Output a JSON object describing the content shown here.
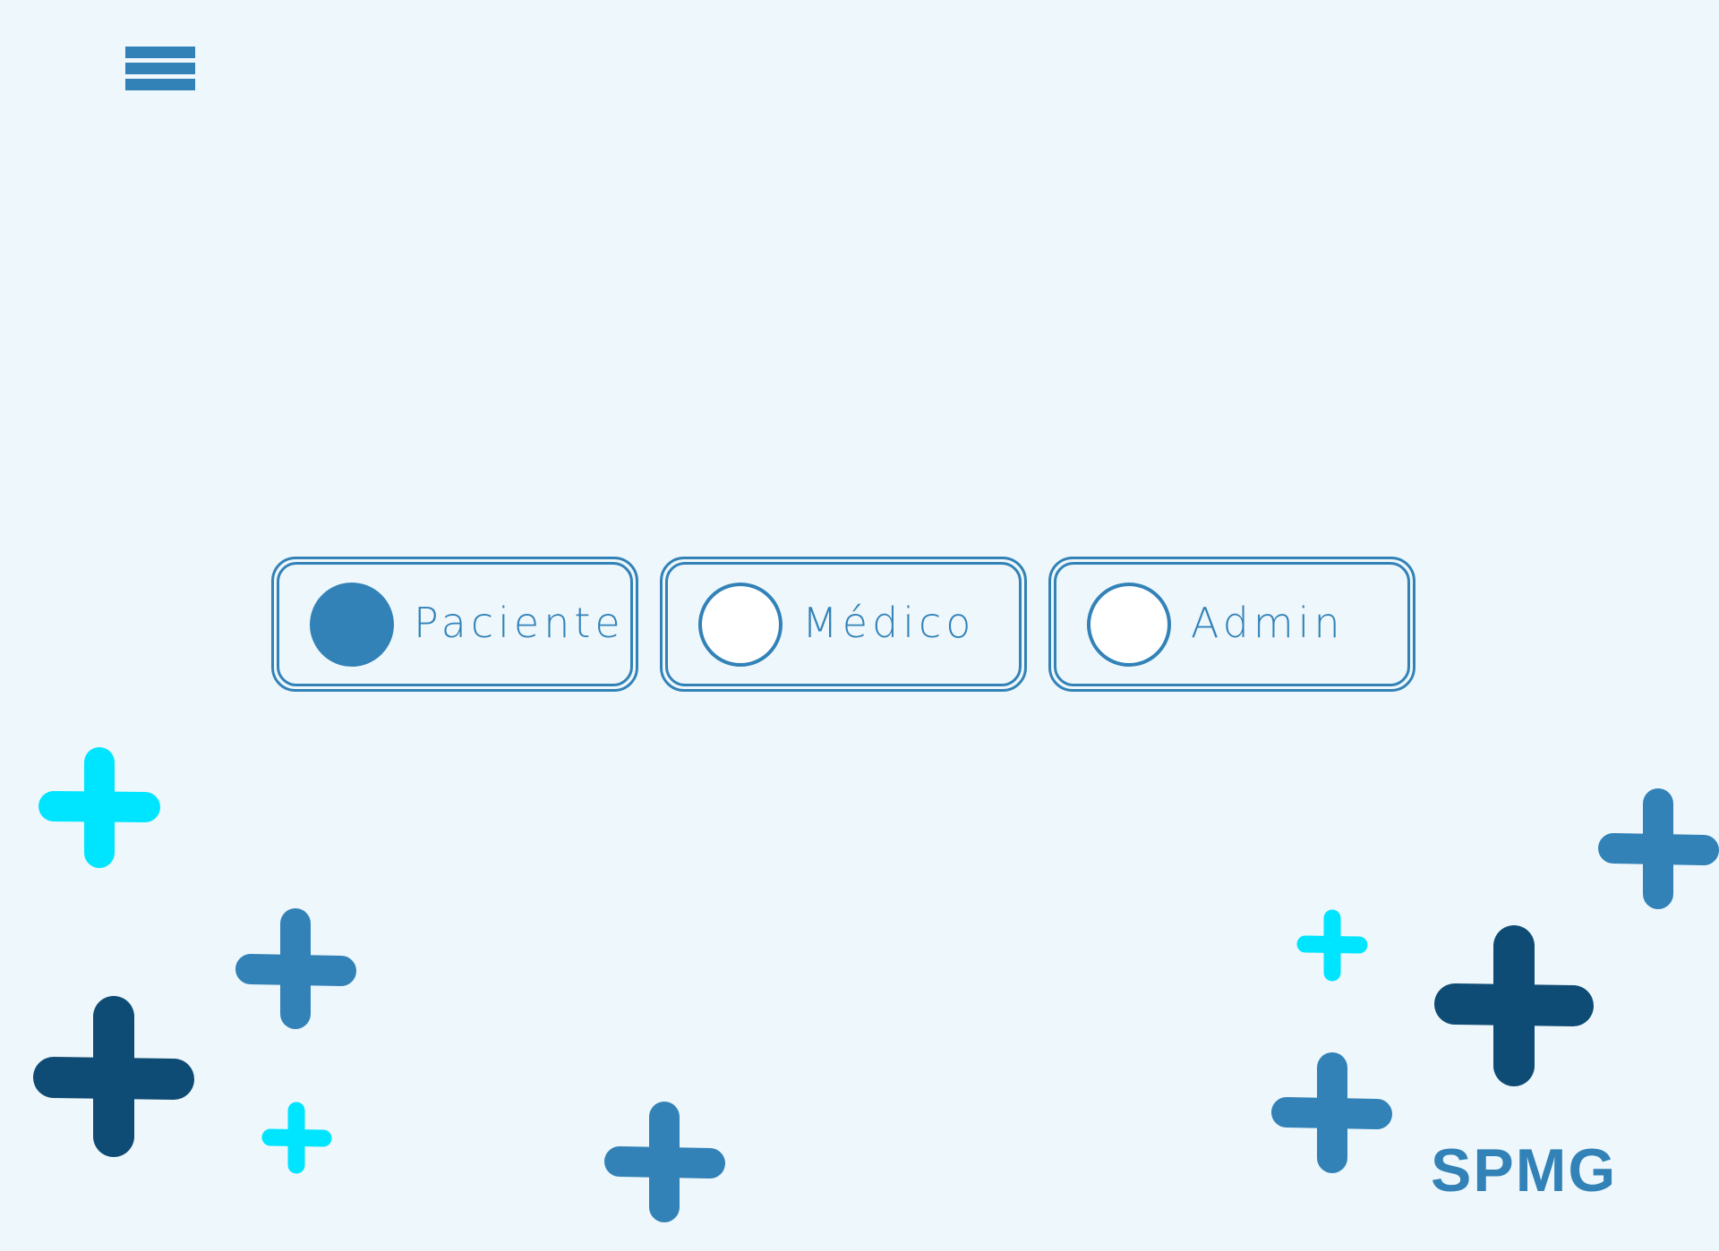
{
  "app": {
    "brand": "SPMG"
  },
  "header": {
    "menu_icon": "hamburger-menu-icon"
  },
  "role_selector": {
    "options": [
      {
        "label": "Paciente",
        "selected": true
      },
      {
        "label": "Médico",
        "selected": false
      },
      {
        "label": "Admin",
        "selected": false
      }
    ]
  },
  "colors": {
    "background": "#eef7fb",
    "primary": "#3282b8",
    "dark": "#0f4c75",
    "accent": "#00e5ff"
  },
  "decorations": {
    "icon": "plus-icon"
  }
}
